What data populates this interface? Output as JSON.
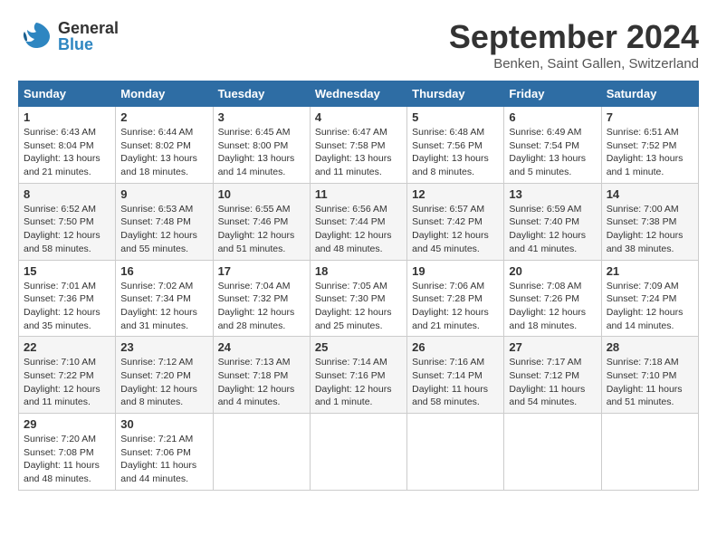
{
  "header": {
    "logo_general": "General",
    "logo_blue": "Blue",
    "month_title": "September 2024",
    "location": "Benken, Saint Gallen, Switzerland"
  },
  "columns": [
    "Sunday",
    "Monday",
    "Tuesday",
    "Wednesday",
    "Thursday",
    "Friday",
    "Saturday"
  ],
  "weeks": [
    [
      {
        "day": "1",
        "sunrise": "Sunrise: 6:43 AM",
        "sunset": "Sunset: 8:04 PM",
        "daylight": "Daylight: 13 hours and 21 minutes."
      },
      {
        "day": "2",
        "sunrise": "Sunrise: 6:44 AM",
        "sunset": "Sunset: 8:02 PM",
        "daylight": "Daylight: 13 hours and 18 minutes."
      },
      {
        "day": "3",
        "sunrise": "Sunrise: 6:45 AM",
        "sunset": "Sunset: 8:00 PM",
        "daylight": "Daylight: 13 hours and 14 minutes."
      },
      {
        "day": "4",
        "sunrise": "Sunrise: 6:47 AM",
        "sunset": "Sunset: 7:58 PM",
        "daylight": "Daylight: 13 hours and 11 minutes."
      },
      {
        "day": "5",
        "sunrise": "Sunrise: 6:48 AM",
        "sunset": "Sunset: 7:56 PM",
        "daylight": "Daylight: 13 hours and 8 minutes."
      },
      {
        "day": "6",
        "sunrise": "Sunrise: 6:49 AM",
        "sunset": "Sunset: 7:54 PM",
        "daylight": "Daylight: 13 hours and 5 minutes."
      },
      {
        "day": "7",
        "sunrise": "Sunrise: 6:51 AM",
        "sunset": "Sunset: 7:52 PM",
        "daylight": "Daylight: 13 hours and 1 minute."
      }
    ],
    [
      {
        "day": "8",
        "sunrise": "Sunrise: 6:52 AM",
        "sunset": "Sunset: 7:50 PM",
        "daylight": "Daylight: 12 hours and 58 minutes."
      },
      {
        "day": "9",
        "sunrise": "Sunrise: 6:53 AM",
        "sunset": "Sunset: 7:48 PM",
        "daylight": "Daylight: 12 hours and 55 minutes."
      },
      {
        "day": "10",
        "sunrise": "Sunrise: 6:55 AM",
        "sunset": "Sunset: 7:46 PM",
        "daylight": "Daylight: 12 hours and 51 minutes."
      },
      {
        "day": "11",
        "sunrise": "Sunrise: 6:56 AM",
        "sunset": "Sunset: 7:44 PM",
        "daylight": "Daylight: 12 hours and 48 minutes."
      },
      {
        "day": "12",
        "sunrise": "Sunrise: 6:57 AM",
        "sunset": "Sunset: 7:42 PM",
        "daylight": "Daylight: 12 hours and 45 minutes."
      },
      {
        "day": "13",
        "sunrise": "Sunrise: 6:59 AM",
        "sunset": "Sunset: 7:40 PM",
        "daylight": "Daylight: 12 hours and 41 minutes."
      },
      {
        "day": "14",
        "sunrise": "Sunrise: 7:00 AM",
        "sunset": "Sunset: 7:38 PM",
        "daylight": "Daylight: 12 hours and 38 minutes."
      }
    ],
    [
      {
        "day": "15",
        "sunrise": "Sunrise: 7:01 AM",
        "sunset": "Sunset: 7:36 PM",
        "daylight": "Daylight: 12 hours and 35 minutes."
      },
      {
        "day": "16",
        "sunrise": "Sunrise: 7:02 AM",
        "sunset": "Sunset: 7:34 PM",
        "daylight": "Daylight: 12 hours and 31 minutes."
      },
      {
        "day": "17",
        "sunrise": "Sunrise: 7:04 AM",
        "sunset": "Sunset: 7:32 PM",
        "daylight": "Daylight: 12 hours and 28 minutes."
      },
      {
        "day": "18",
        "sunrise": "Sunrise: 7:05 AM",
        "sunset": "Sunset: 7:30 PM",
        "daylight": "Daylight: 12 hours and 25 minutes."
      },
      {
        "day": "19",
        "sunrise": "Sunrise: 7:06 AM",
        "sunset": "Sunset: 7:28 PM",
        "daylight": "Daylight: 12 hours and 21 minutes."
      },
      {
        "day": "20",
        "sunrise": "Sunrise: 7:08 AM",
        "sunset": "Sunset: 7:26 PM",
        "daylight": "Daylight: 12 hours and 18 minutes."
      },
      {
        "day": "21",
        "sunrise": "Sunrise: 7:09 AM",
        "sunset": "Sunset: 7:24 PM",
        "daylight": "Daylight: 12 hours and 14 minutes."
      }
    ],
    [
      {
        "day": "22",
        "sunrise": "Sunrise: 7:10 AM",
        "sunset": "Sunset: 7:22 PM",
        "daylight": "Daylight: 12 hours and 11 minutes."
      },
      {
        "day": "23",
        "sunrise": "Sunrise: 7:12 AM",
        "sunset": "Sunset: 7:20 PM",
        "daylight": "Daylight: 12 hours and 8 minutes."
      },
      {
        "day": "24",
        "sunrise": "Sunrise: 7:13 AM",
        "sunset": "Sunset: 7:18 PM",
        "daylight": "Daylight: 12 hours and 4 minutes."
      },
      {
        "day": "25",
        "sunrise": "Sunrise: 7:14 AM",
        "sunset": "Sunset: 7:16 PM",
        "daylight": "Daylight: 12 hours and 1 minute."
      },
      {
        "day": "26",
        "sunrise": "Sunrise: 7:16 AM",
        "sunset": "Sunset: 7:14 PM",
        "daylight": "Daylight: 11 hours and 58 minutes."
      },
      {
        "day": "27",
        "sunrise": "Sunrise: 7:17 AM",
        "sunset": "Sunset: 7:12 PM",
        "daylight": "Daylight: 11 hours and 54 minutes."
      },
      {
        "day": "28",
        "sunrise": "Sunrise: 7:18 AM",
        "sunset": "Sunset: 7:10 PM",
        "daylight": "Daylight: 11 hours and 51 minutes."
      }
    ],
    [
      {
        "day": "29",
        "sunrise": "Sunrise: 7:20 AM",
        "sunset": "Sunset: 7:08 PM",
        "daylight": "Daylight: 11 hours and 48 minutes."
      },
      {
        "day": "30",
        "sunrise": "Sunrise: 7:21 AM",
        "sunset": "Sunset: 7:06 PM",
        "daylight": "Daylight: 11 hours and 44 minutes."
      },
      null,
      null,
      null,
      null,
      null
    ]
  ]
}
